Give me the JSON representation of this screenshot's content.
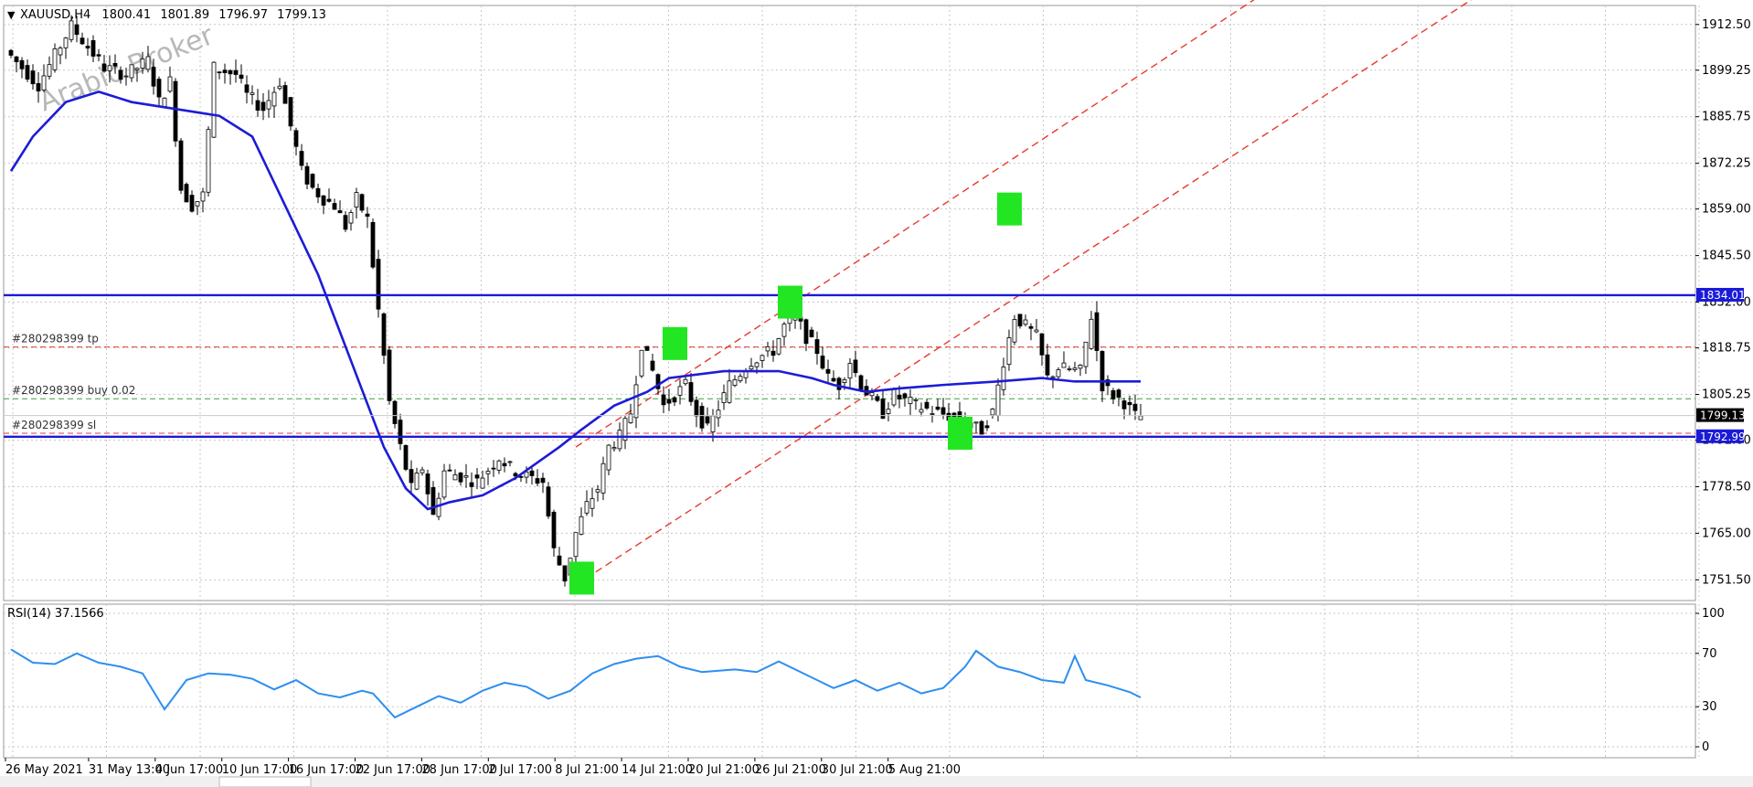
{
  "header": {
    "symbol": "XAUUSD,H4",
    "open": "1800.41",
    "high": "1801.89",
    "low": "1796.97",
    "close": "1799.13"
  },
  "watermark": "Arabic Broker",
  "rsi_panel": {
    "title": "RSI(14) 37.1566"
  },
  "colors": {
    "candle": "#000000",
    "ma": "#1c1cd6",
    "level_line": "#1a1ad8",
    "channel": "#e83a2e",
    "rsi": "#2d8ef0",
    "marker": "#22e622",
    "grid": "#c8c8c8",
    "tp_line": "#e83a2e",
    "entry_line": "#3aa03a"
  },
  "chart_data": [
    {
      "type": "candlestick",
      "symbol": "XAUUSD",
      "timeframe": "H4",
      "ylim": [
        1745.5,
        1918
      ],
      "y_ticks": [
        "1912.50",
        "1899.25",
        "1885.75",
        "1872.25",
        "1859.00",
        "1845.50",
        "1832.00",
        "1818.75",
        "1805.25",
        "1792.00",
        "1778.50",
        "1765.00",
        "1751.50"
      ],
      "x_ticks": [
        "26 May 2021",
        "31 May 13:00",
        "4 Jun 17:00",
        "10 Jun 17:00",
        "16 Jun 17:00",
        "22 Jun 17:00",
        "28 Jun 17:00",
        "2 Jul 17:00",
        "8 Jul 21:00",
        "14 Jul 21:00",
        "20 Jul 21:00",
        "26 Jul 21:00",
        "30 Jul 21:00",
        "5 Aug 21:00"
      ],
      "price_path": [
        [
          0,
          1905
        ],
        [
          6,
          1895
        ],
        [
          12,
          1912
        ],
        [
          18,
          1900
        ],
        [
          22,
          1898
        ],
        [
          26,
          1902
        ],
        [
          28,
          1890
        ],
        [
          30,
          1896
        ],
        [
          32,
          1865
        ],
        [
          34,
          1860
        ],
        [
          36,
          1863
        ],
        [
          38,
          1900
        ],
        [
          42,
          1898
        ],
        [
          44,
          1892
        ],
        [
          47,
          1888
        ],
        [
          50,
          1896
        ],
        [
          54,
          1870
        ],
        [
          56,
          1865
        ],
        [
          58,
          1862
        ],
        [
          60,
          1860
        ],
        [
          62,
          1854
        ],
        [
          64,
          1862
        ],
        [
          66,
          1856
        ],
        [
          70,
          1803
        ],
        [
          72,
          1790
        ],
        [
          74,
          1778
        ],
        [
          76,
          1784
        ],
        [
          78,
          1770
        ],
        [
          80,
          1783
        ],
        [
          86,
          1780
        ],
        [
          90,
          1787
        ],
        [
          92,
          1784
        ],
        [
          94,
          1782
        ],
        [
          98,
          1780
        ],
        [
          100,
          1760
        ],
        [
          102,
          1752
        ],
        [
          104,
          1765
        ],
        [
          106,
          1773
        ],
        [
          108,
          1778
        ],
        [
          110,
          1790
        ],
        [
          112,
          1793
        ],
        [
          114,
          1800
        ],
        [
          116,
          1820
        ],
        [
          118,
          1812
        ],
        [
          120,
          1802
        ],
        [
          124,
          1808
        ],
        [
          126,
          1800
        ],
        [
          128,
          1795
        ],
        [
          132,
          1808
        ],
        [
          136,
          1815
        ],
        [
          140,
          1818
        ],
        [
          142,
          1825
        ],
        [
          144,
          1828
        ],
        [
          146,
          1822
        ],
        [
          148,
          1818
        ],
        [
          150,
          1810
        ],
        [
          152,
          1808
        ],
        [
          154,
          1815
        ],
        [
          156,
          1808
        ],
        [
          160,
          1800
        ],
        [
          162,
          1805
        ],
        [
          166,
          1802
        ],
        [
          170,
          1800
        ],
        [
          174,
          1798
        ],
        [
          176,
          1796
        ],
        [
          178,
          1795
        ],
        [
          180,
          1800
        ],
        [
          182,
          1815
        ],
        [
          184,
          1828
        ],
        [
          186,
          1825
        ],
        [
          188,
          1822
        ],
        [
          190,
          1810
        ],
        [
          192,
          1813
        ],
        [
          196,
          1812
        ],
        [
          198,
          1828
        ],
        [
          200,
          1808
        ],
        [
          202,
          1805
        ],
        [
          204,
          1803
        ],
        [
          206,
          1799
        ]
      ],
      "moving_average": [
        [
          0,
          1870
        ],
        [
          4,
          1880
        ],
        [
          10,
          1890
        ],
        [
          16,
          1893
        ],
        [
          22,
          1890
        ],
        [
          30,
          1888
        ],
        [
          38,
          1886
        ],
        [
          44,
          1880
        ],
        [
          50,
          1860
        ],
        [
          56,
          1840
        ],
        [
          62,
          1815
        ],
        [
          68,
          1790
        ],
        [
          72,
          1778
        ],
        [
          76,
          1772
        ],
        [
          80,
          1774
        ],
        [
          86,
          1776
        ],
        [
          92,
          1781
        ],
        [
          100,
          1790
        ],
        [
          104,
          1795
        ],
        [
          110,
          1802
        ],
        [
          116,
          1806
        ],
        [
          120,
          1810
        ],
        [
          130,
          1812
        ],
        [
          140,
          1812
        ],
        [
          146,
          1810
        ],
        [
          150,
          1808
        ],
        [
          156,
          1806
        ],
        [
          162,
          1807
        ],
        [
          170,
          1808
        ],
        [
          180,
          1809
        ],
        [
          188,
          1810
        ],
        [
          194,
          1809
        ],
        [
          200,
          1809
        ],
        [
          206,
          1809
        ]
      ],
      "horizontal_levels": [
        {
          "price": 1834.01,
          "label": "1834.01",
          "kind": "level"
        },
        {
          "price": 1792.99,
          "label": "1792.99",
          "kind": "level"
        },
        {
          "price": 1799.13,
          "label": "1799.13",
          "kind": "bid"
        }
      ],
      "orders": [
        {
          "label": "#280298399 tp",
          "price": 1819,
          "kind": "tp"
        },
        {
          "label": "#280298399 buy 0.02",
          "price": 1804,
          "kind": "entry"
        },
        {
          "label": "#280298399 sl",
          "price": 1794,
          "kind": "sl"
        }
      ],
      "channel_lines": [
        {
          "from": [
            103,
            1750
          ],
          "to": [
            206,
            1857
          ]
        },
        {
          "from": [
            103,
            1790
          ],
          "to": [
            206,
            1898
          ]
        }
      ],
      "markers": [
        {
          "x": 104,
          "price": 1752
        },
        {
          "x": 121,
          "price": 1820
        },
        {
          "x": 142,
          "price": 1832
        },
        {
          "x": 173,
          "price": 1794
        },
        {
          "x": 182,
          "price": 1859
        }
      ]
    },
    {
      "type": "line",
      "title": "RSI(14) 37.1566",
      "ylim": [
        0,
        100
      ],
      "y_ticks": [
        "100",
        "70",
        "30",
        "0"
      ],
      "values": [
        [
          0,
          73
        ],
        [
          4,
          63
        ],
        [
          8,
          62
        ],
        [
          12,
          70
        ],
        [
          16,
          63
        ],
        [
          20,
          60
        ],
        [
          24,
          55
        ],
        [
          28,
          28
        ],
        [
          32,
          50
        ],
        [
          36,
          55
        ],
        [
          40,
          54
        ],
        [
          44,
          51
        ],
        [
          48,
          43
        ],
        [
          52,
          50
        ],
        [
          56,
          40
        ],
        [
          60,
          37
        ],
        [
          64,
          42
        ],
        [
          66,
          40
        ],
        [
          70,
          22
        ],
        [
          74,
          30
        ],
        [
          78,
          38
        ],
        [
          82,
          33
        ],
        [
          86,
          42
        ],
        [
          90,
          48
        ],
        [
          94,
          45
        ],
        [
          98,
          36
        ],
        [
          102,
          42
        ],
        [
          106,
          55
        ],
        [
          110,
          62
        ],
        [
          114,
          66
        ],
        [
          118,
          68
        ],
        [
          122,
          60
        ],
        [
          126,
          56
        ],
        [
          132,
          58
        ],
        [
          136,
          56
        ],
        [
          140,
          64
        ],
        [
          144,
          56
        ],
        [
          150,
          44
        ],
        [
          154,
          50
        ],
        [
          158,
          42
        ],
        [
          162,
          48
        ],
        [
          166,
          40
        ],
        [
          170,
          44
        ],
        [
          174,
          60
        ],
        [
          176,
          72
        ],
        [
          180,
          60
        ],
        [
          184,
          56
        ],
        [
          188,
          50
        ],
        [
          192,
          48
        ],
        [
          194,
          68
        ],
        [
          196,
          50
        ],
        [
          200,
          46
        ],
        [
          204,
          41
        ],
        [
          206,
          37
        ]
      ]
    }
  ]
}
